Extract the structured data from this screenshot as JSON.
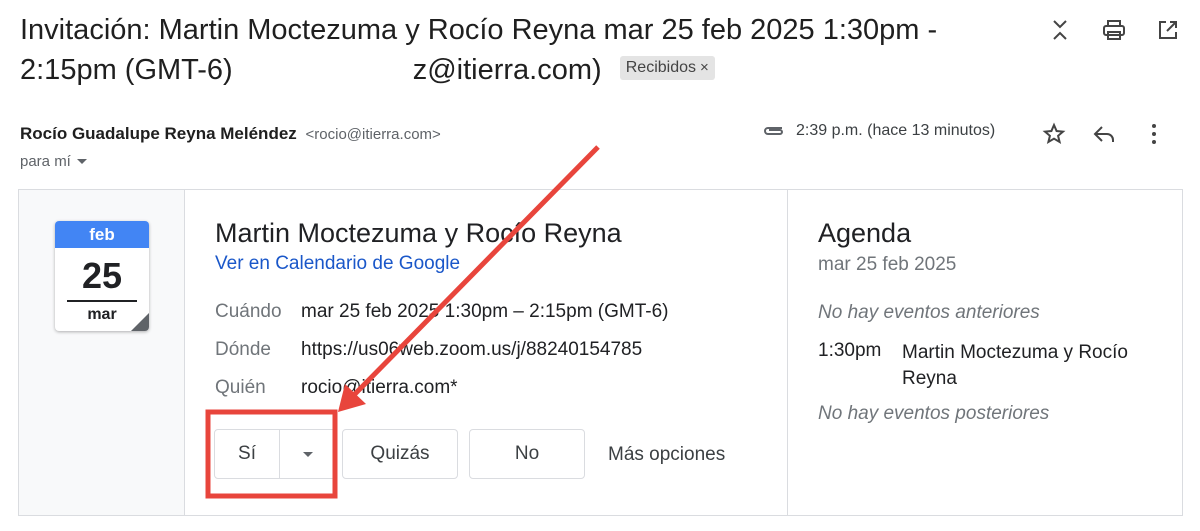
{
  "subject": {
    "line1": "Invitación: Martin Moctezuma y Rocío Reyna mar 25 feb 2025 1:30pm -",
    "line2_start": "2:15pm (GMT-6)",
    "line2_end": "z@itierra.com)",
    "label": "Recibidos",
    "label_close": "×"
  },
  "sender": {
    "name": "Rocío Guadalupe Reyna Meléndez",
    "email": "<rocio@itierra.com>",
    "to": "para mí",
    "time": "2:39 p.m. (hace 13 minutos)"
  },
  "invite": {
    "month": "feb",
    "day": "25",
    "weekday": "mar",
    "title": "Martin Moctezuma y Rocío Reyna",
    "calendar_link": "Ver en Calendario de Google",
    "rows": [
      {
        "key": "Cuándo",
        "value": "mar 25 feb 2025 1:30pm – 2:15pm (GMT-6)"
      },
      {
        "key": "Dónde",
        "value": "https://us06web.zoom.us/j/88240154785"
      },
      {
        "key": "Quién",
        "value": "rocio@itierra.com*"
      }
    ],
    "rsvp": {
      "yes": "Sí",
      "maybe": "Quizás",
      "no": "No",
      "more": "Más opciones"
    }
  },
  "agenda": {
    "title": "Agenda",
    "date": "mar 25 feb 2025",
    "before": "No hay eventos anteriores",
    "event_time": "1:30pm",
    "event_name": "Martin Moctezuma y Rocío Reyna",
    "after": "No hay eventos posteriores"
  },
  "colors": {
    "annotation": "#e8453c",
    "link": "#1a57c9",
    "calendar_header": "#4285f4"
  }
}
